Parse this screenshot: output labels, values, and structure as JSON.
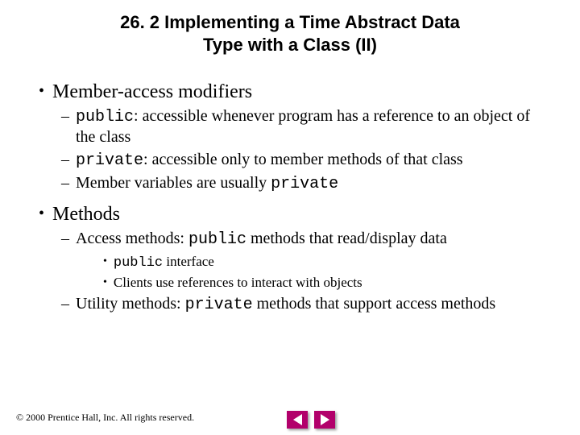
{
  "title_line1": "26. 2   Implementing a Time Abstract Data",
  "title_line2": "Type with a Class (II)",
  "s1": {
    "heading": "Member-access modifiers",
    "i1_code": "public",
    "i1_rest": ": accessible whenever program has a reference to an object of the class",
    "i2_code": "private",
    "i2_rest": ": accessible only to member methods of that class",
    "i3_a": "Member variables are usually ",
    "i3_code": "private"
  },
  "s2": {
    "heading": "Methods",
    "i1_a": "Access methods: ",
    "i1_code": "public",
    "i1_b": " methods that read/display data",
    "i1s1_code": "public",
    "i1s1_rest": " interface",
    "i1s2": "Clients use references to interact with objects",
    "i2_a": "Utility methods: ",
    "i2_code": "private",
    "i2_b": " methods that support access methods"
  },
  "footer": "© 2000 Prentice Hall, Inc. All rights reserved."
}
